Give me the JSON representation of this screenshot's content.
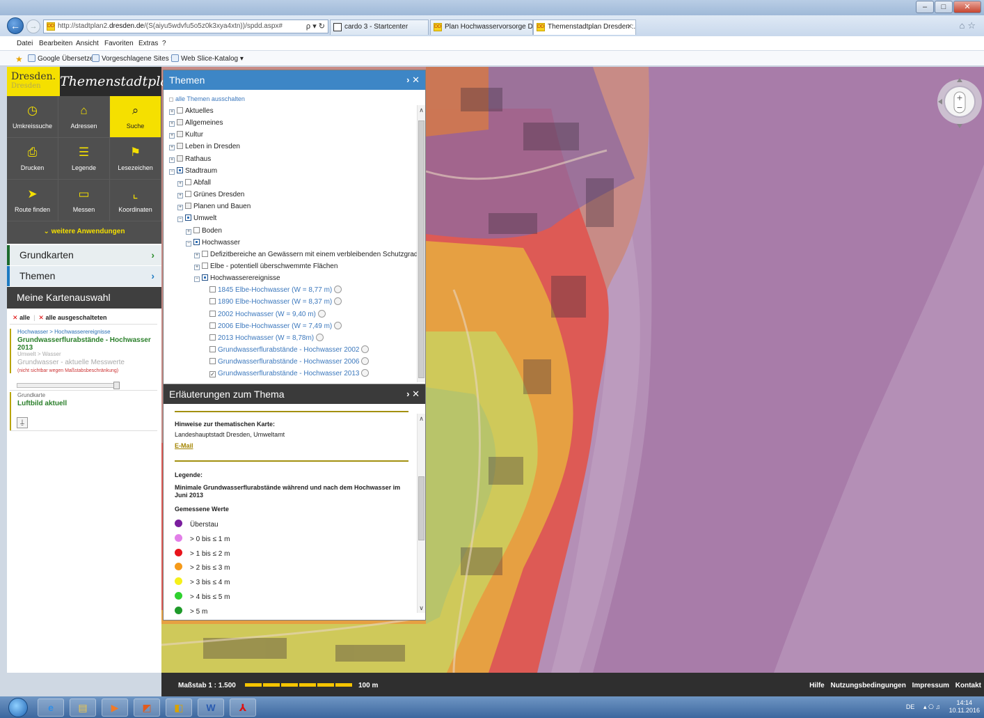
{
  "browser": {
    "url_prefix": "http://stadtplan2.",
    "url_domain": "dresden.de",
    "url_rest": "/(S(aiyu5wdvfu5o5z0k3xya4xtn))/spdd.aspx#",
    "addr_controls": "ρ ▾ ↻",
    "tabs": [
      {
        "label": "cardo 3 - Startcenter"
      },
      {
        "label": "Plan Hochwasservorsorge Dres..."
      },
      {
        "label": "Themenstadtplan Dresden :..."
      }
    ],
    "menu": [
      "Datei",
      "Bearbeiten",
      "Ansicht",
      "Favoriten",
      "Extras",
      "?"
    ],
    "favorites": [
      "Google Übersetzer",
      "Vorgeschlagene Sites ▾",
      "Web Slice-Katalog ▾"
    ]
  },
  "sidebar": {
    "logo_line1": "Dresden.",
    "logo_line2": "Dresden",
    "brand": "Themenstadtplan",
    "tiles": [
      {
        "label": "Umkreissuche",
        "icon": "◷"
      },
      {
        "label": "Adressen",
        "icon": "⌂"
      },
      {
        "label": "Suche",
        "icon": "⌕"
      },
      {
        "label": "Drucken",
        "icon": "⎙"
      },
      {
        "label": "Legende",
        "icon": "☰"
      },
      {
        "label": "Lesezeichen",
        "icon": "⚑"
      },
      {
        "label": "Route finden",
        "icon": "➤"
      },
      {
        "label": "Messen",
        "icon": "▭"
      },
      {
        "label": "Koordinaten",
        "icon": "⌞"
      }
    ],
    "weitere": "⌄ weitere Anwendungen",
    "grundkarten": "Grundkarten",
    "themen": "Themen",
    "meine": "Meine Kartenauswahl",
    "sel_all": "alle",
    "sel_all_off": "alle ausgeschalteten",
    "selection": [
      {
        "path": "Hochwasser  >  Hochwasserereignisse",
        "name": "Grundwasserflurabstände - Hochwasser 2013"
      },
      {
        "path": "Umwelt  >  Wasser",
        "name": "Grundwasser - aktuelle Messwerte",
        "warn": "(nicht sichtbar wegen Maßstabsbeschränkung)"
      },
      {
        "path": "Grundkarte",
        "name": "Luftbild aktuell"
      }
    ]
  },
  "themen_panel": {
    "title": "Themen",
    "controls": "› ✕",
    "all_off": "alle Themen ausschalten",
    "tree": [
      {
        "label": "Aktuelles",
        "level": 0,
        "exp": "+",
        "cb": "",
        "cls": ""
      },
      {
        "label": "Allgemeines",
        "level": 0,
        "exp": "+",
        "cb": "part",
        "cls": ""
      },
      {
        "label": "Kultur",
        "level": 0,
        "exp": "+",
        "cb": "part",
        "cls": ""
      },
      {
        "label": "Leben in Dresden",
        "level": 0,
        "exp": "+",
        "cb": "part",
        "cls": ""
      },
      {
        "label": "Rathaus",
        "level": 0,
        "exp": "+",
        "cb": "part",
        "cls": ""
      },
      {
        "label": "Stadtraum",
        "level": 0,
        "exp": "−",
        "cb": "full",
        "cls": ""
      },
      {
        "label": "Abfall",
        "level": 1,
        "exp": "+",
        "cb": "",
        "cls": ""
      },
      {
        "label": "Grünes Dresden",
        "level": 1,
        "exp": "+",
        "cb": "",
        "cls": ""
      },
      {
        "label": "Planen und Bauen",
        "level": 1,
        "exp": "+",
        "cb": "part",
        "cls": ""
      },
      {
        "label": "Umwelt",
        "level": 1,
        "exp": "−",
        "cb": "full",
        "cls": ""
      },
      {
        "label": "Boden",
        "level": 2,
        "exp": "+",
        "cb": "",
        "cls": ""
      },
      {
        "label": "Hochwasser",
        "level": 2,
        "exp": "−",
        "cb": "full",
        "cls": ""
      },
      {
        "label": "Defizitbereiche an Gewässern mit einem verbleibenden Schutzgrad kleiner HQ",
        "level": 3,
        "exp": "+",
        "cb": "",
        "cls": ""
      },
      {
        "label": "Elbe - potentiell überschwemmte Flächen",
        "level": 3,
        "exp": "+",
        "cb": "",
        "cls": ""
      },
      {
        "label": "Hochwasserereignisse",
        "level": 3,
        "exp": "−",
        "cb": "full",
        "cls": ""
      },
      {
        "label": "1845 Elbe-Hochwasser (W = 8,77 m)",
        "level": 4,
        "exp": "",
        "cb": "",
        "cls": "link",
        "mag": true
      },
      {
        "label": "1890 Elbe-Hochwasser (W = 8,37 m)",
        "level": 4,
        "exp": "",
        "cb": "",
        "cls": "link",
        "mag": true
      },
      {
        "label": "2002 Hochwasser (W = 9,40 m)",
        "level": 4,
        "exp": "",
        "cb": "",
        "cls": "link",
        "mag": true
      },
      {
        "label": "2006 Elbe-Hochwasser (W = 7,49 m)",
        "level": 4,
        "exp": "",
        "cb": "",
        "cls": "link",
        "mag": true
      },
      {
        "label": "2013 Hochwasser (W = 8,78m)",
        "level": 4,
        "exp": "",
        "cb": "",
        "cls": "link",
        "mag": true
      },
      {
        "label": "Grundwasserflurabstände - Hochwasser 2002",
        "level": 4,
        "exp": "",
        "cb": "",
        "cls": "link",
        "mag": true
      },
      {
        "label": "Grundwasserflurabstände - Hochwasser 2006",
        "level": 4,
        "exp": "",
        "cb": "",
        "cls": "link",
        "mag": true
      },
      {
        "label": "Grundwasserflurabstände - Hochwasser 2013",
        "level": 4,
        "exp": "",
        "cb": "checked",
        "cls": "link",
        "mag": true
      }
    ]
  },
  "erl_panel": {
    "title": "Erläuterungen zum Thema",
    "controls": "› ✕",
    "hinweise_head": "Hinweise zur thematischen Karte:",
    "hinweise_text": "Landeshauptstadt Dresden, Umweltamt",
    "email": "E-Mail",
    "legende_head": "Legende:",
    "legende_desc1": "Minimale Grundwasserflurabstände während und nach dem Hochwasser im",
    "legende_desc2": "Juni 2013",
    "gemessen": "Gemessene Werte",
    "legend": [
      {
        "label": "Überstau",
        "color": "#7a1e9e"
      },
      {
        "label": "> 0 bis ≤ 1 m",
        "color": "#e27fe8"
      },
      {
        "label": "> 1 bis ≤ 2 m",
        "color": "#e8141c"
      },
      {
        "label": "> 2 bis ≤ 3 m",
        "color": "#f59a1a"
      },
      {
        "label": "> 3 bis ≤ 4 m",
        "color": "#f5f01a"
      },
      {
        "label": "> 4 bis ≤ 5 m",
        "color": "#2fd12f"
      },
      {
        "label": "> 5 m",
        "color": "#1f9a2a"
      }
    ]
  },
  "statusbar": {
    "scale": "Maßstab 1 : 1.500",
    "scale_len": "100 m",
    "links": [
      "Hilfe",
      "Nutzungsbedingungen",
      "Impressum",
      "Kontakt"
    ]
  },
  "taskbar": {
    "lang": "DE",
    "tray_icons": "▴  ⎔  ♫",
    "time": "14:14",
    "date": "10.11.2016"
  }
}
